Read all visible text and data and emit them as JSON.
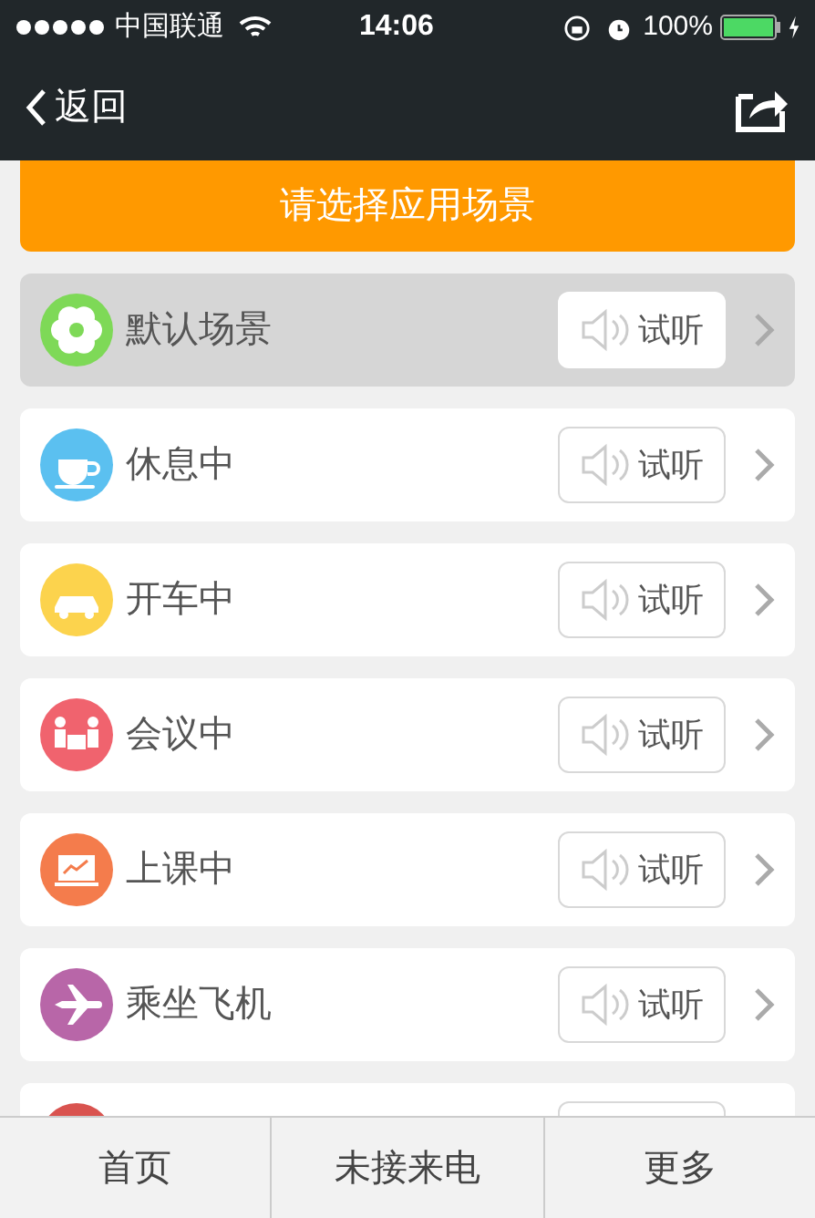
{
  "status_bar": {
    "carrier": "中国联通",
    "time": "14:06",
    "battery": "100%"
  },
  "nav": {
    "back": "返回"
  },
  "header": {
    "title": "请选择应用场景"
  },
  "rows": [
    {
      "kind": "scene",
      "label": "默认场景",
      "button": "试听",
      "selected": true,
      "color": "#7ed957"
    },
    {
      "kind": "scene",
      "label": "休息中",
      "button": "试听",
      "selected": false,
      "color": "#5bc0f0"
    },
    {
      "kind": "scene",
      "label": "开车中",
      "button": "试听",
      "selected": false,
      "color": "#fcd34d"
    },
    {
      "kind": "scene",
      "label": "会议中",
      "button": "试听",
      "selected": false,
      "color": "#f0636e"
    },
    {
      "kind": "scene",
      "label": "上课中",
      "button": "试听",
      "selected": false,
      "color": "#f47c4c"
    },
    {
      "kind": "scene",
      "label": "乘坐飞机",
      "button": "试听",
      "selected": false,
      "color": "#b866a8"
    },
    {
      "kind": "partial",
      "color": "#d9534f"
    }
  ],
  "tabs": [
    {
      "label": "首页"
    },
    {
      "label": "未接来电"
    },
    {
      "label": "更多"
    }
  ]
}
